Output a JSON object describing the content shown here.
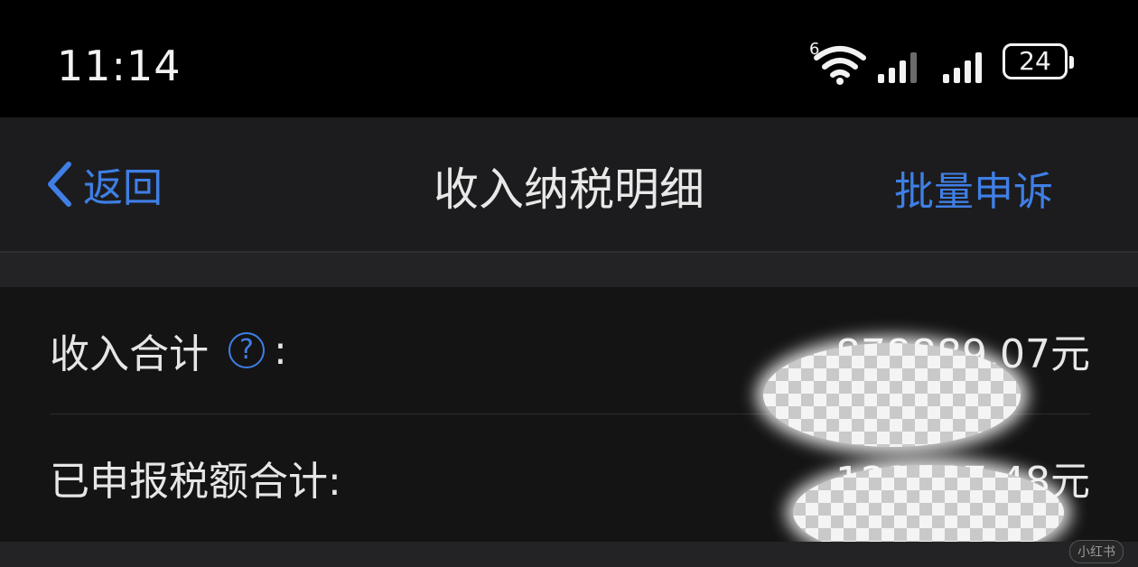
{
  "status_bar": {
    "time": "11:14",
    "wifi_badge": "6",
    "battery_level": "24",
    "icons": [
      "wifi-icon",
      "signal-icon",
      "signal-icon",
      "battery-icon"
    ]
  },
  "nav": {
    "back_label": "返回",
    "title": "收入纳税明细",
    "action_label": "批量申诉"
  },
  "summary": {
    "income_total_label": "收入合计",
    "income_total_colon": ":",
    "income_total_value": "878889.07元",
    "tax_total_label": "已申报税额合计:",
    "tax_total_value": "122167.48元"
  },
  "watermark": "小红书",
  "colors": {
    "accent": "#3f7fe6",
    "background": "#0d0d0d",
    "card": "#141414",
    "nav": "#1c1c1e"
  }
}
